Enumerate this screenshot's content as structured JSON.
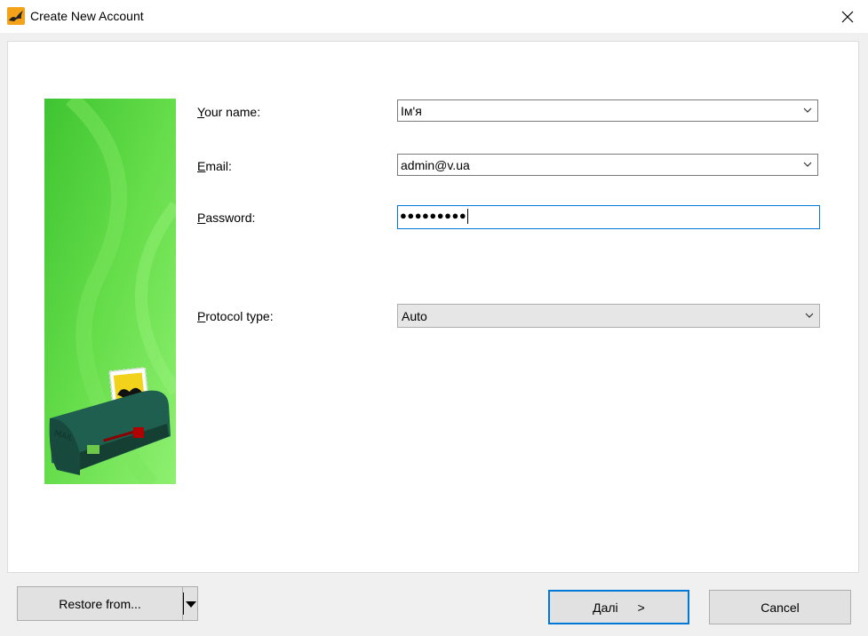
{
  "window": {
    "title": "Create New Account"
  },
  "form": {
    "name_label_prefix": "Y",
    "name_label_rest": "our name:",
    "name_value": "Ім'я",
    "email_label_prefix": "E",
    "email_label_rest": "mail:",
    "email_value": "admin@v.ua",
    "password_label_prefix": "P",
    "password_label_rest": "assword:",
    "password_value": "●●●●●●●●●",
    "protocol_label_prefix": "P",
    "protocol_label_rest": "rotocol type:",
    "protocol_value": "Auto"
  },
  "buttons": {
    "restore_label": "Restore from...",
    "next_label": "Далі",
    "next_glyph": ">",
    "cancel_label": "Cancel"
  },
  "colors": {
    "focus_border": "#0078d7",
    "banner_green": "#5cd93f"
  }
}
